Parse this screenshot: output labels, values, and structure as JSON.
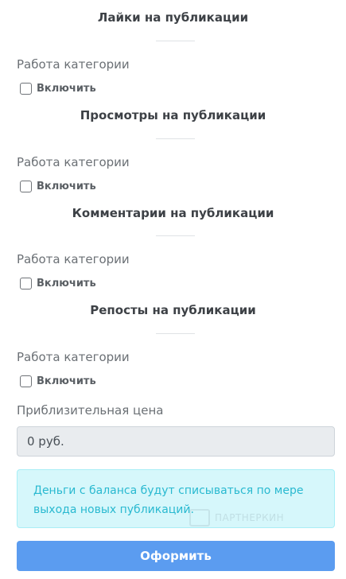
{
  "sections": [
    {
      "title": "Лайки на публикации",
      "category_label": "Работа категории",
      "checkbox_label": "Включить",
      "checked": false
    },
    {
      "title": "Просмотры на публикации",
      "category_label": "Работа категории",
      "checkbox_label": "Включить",
      "checked": false
    },
    {
      "title": "Комментарии на публикации",
      "category_label": "Работа категории",
      "checkbox_label": "Включить",
      "checked": false
    },
    {
      "title": "Репосты на публикации",
      "category_label": "Работа категории",
      "checkbox_label": "Включить",
      "checked": false
    }
  ],
  "price": {
    "label": "Приблизительная цена",
    "value": "0 руб."
  },
  "alert": {
    "text": "Деньги с баланса будут списываться по мере выхода новых публикаций."
  },
  "watermark": {
    "text": "ПАРТНЕРКИН"
  },
  "submit": {
    "label": "Оформить"
  },
  "colors": {
    "accent": "#5b9cf0",
    "alert_bg": "#d6f7fb",
    "alert_text": "#29b9d0"
  }
}
